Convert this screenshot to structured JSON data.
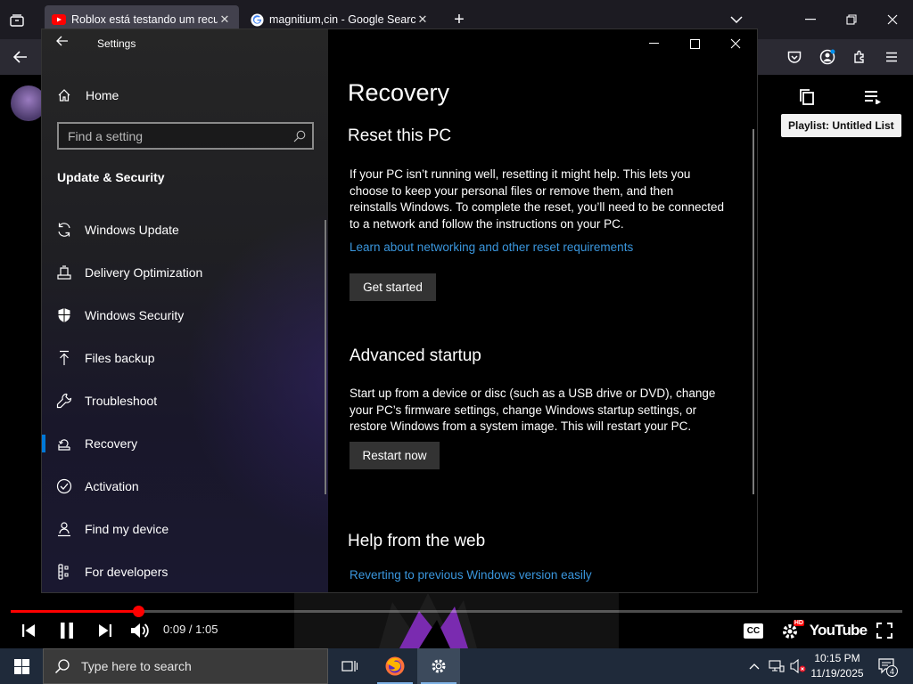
{
  "browser": {
    "tabs": [
      {
        "title": "Roblox está testando um recurso",
        "favicon": "youtube-icon",
        "active": true
      },
      {
        "title": "magnitium,cin - Google Search",
        "favicon": "google-icon",
        "active": false
      }
    ],
    "new_tab": "+",
    "tab_close": "✕"
  },
  "youtube": {
    "playlist_tooltip": "Playlist: Untitled List",
    "time_text": "0:09 / 1:05",
    "progress": 0.143,
    "logo_text": "YouTube",
    "hd_badge": "HD",
    "cc_label": "CC"
  },
  "settings": {
    "window_title": "Settings",
    "home_label": "Home",
    "search_placeholder": "Find a setting",
    "section_title": "Update & Security",
    "nav_items": [
      {
        "label": "Windows Update",
        "icon": "sync-icon",
        "selected": false
      },
      {
        "label": "Delivery Optimization",
        "icon": "delivery-icon",
        "selected": false
      },
      {
        "label": "Windows Security",
        "icon": "shield-icon",
        "selected": false
      },
      {
        "label": "Files backup",
        "icon": "backup-arrow-icon",
        "selected": false
      },
      {
        "label": "Troubleshoot",
        "icon": "wrench-icon",
        "selected": false
      },
      {
        "label": "Recovery",
        "icon": "recovery-icon",
        "selected": true
      },
      {
        "label": "Activation",
        "icon": "check-circle-icon",
        "selected": false
      },
      {
        "label": "Find my device",
        "icon": "person-pin-icon",
        "selected": false
      },
      {
        "label": "For developers",
        "icon": "developer-icon",
        "selected": false
      }
    ],
    "page_title": "Recovery",
    "reset": {
      "heading": "Reset this PC",
      "body": "If your PC isn’t running well, resetting it might help. This lets you choose to keep your personal files or remove them, and then reinstalls Windows. To complete the reset, you’ll need to be connected to a network and follow the instructions on your PC.",
      "link": "Learn about networking and other reset requirements",
      "button": "Get started"
    },
    "advanced": {
      "heading": "Advanced startup",
      "body": "Start up from a device or disc (such as a USB drive or DVD), change your PC’s firmware settings, change Windows startup settings, or restore Windows from a system image. This will restart your PC.",
      "button": "Restart now"
    },
    "help": {
      "heading": "Help from the web",
      "link": "Reverting to previous Windows version easily"
    }
  },
  "taskbar": {
    "search_placeholder": "Type here to search",
    "time": "10:15 PM",
    "date": "11/19/2025",
    "notification_count": "4"
  },
  "colors": {
    "accent_blue": "#0078d7",
    "link_blue": "#3a96dd",
    "youtube_red": "#ff0000",
    "taskbar": "#1f2a3a"
  }
}
